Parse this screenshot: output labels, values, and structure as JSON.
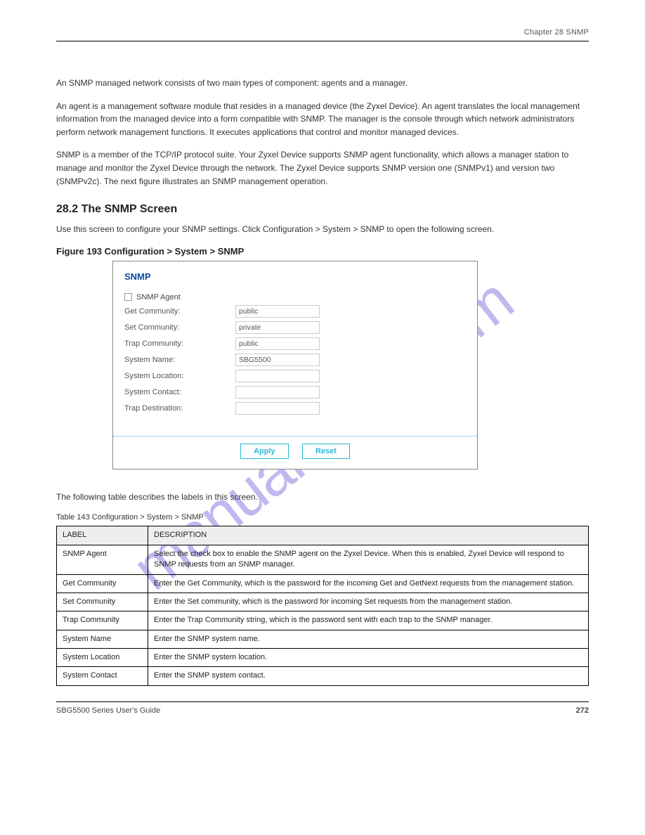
{
  "header": {
    "chapter": "Chapter 28 SNMP"
  },
  "intro": {
    "p1": "An SNMP managed network consists of two main types of component: agents and a manager.",
    "p2": "An agent is a management software module that resides in a managed device (the Zyxel Device). An agent translates the local management information from the managed device into a form compatible with SNMP. The manager is the console through which network administrators perform network management functions. It executes applications that control and monitor managed devices.",
    "p3": "SNMP is a member of the TCP/IP protocol suite. Your Zyxel Device supports SNMP agent functionality, which allows a manager station to manage and monitor the Zyxel Device through the network. The Zyxel Device supports SNMP version one (SNMPv1) and version two (SNMPv2c). The next figure illustrates an SNMP management operation."
  },
  "section": {
    "title": "28.2  The SNMP Screen",
    "lead": "Use this screen to configure your SNMP settings. Click Configuration > System > SNMP to open the following screen.",
    "figcaption": "Figure 193   Configuration > System > SNMP"
  },
  "panel": {
    "title": "SNMP",
    "agent_label": "SNMP Agent",
    "fields": [
      {
        "label": "Get Community:",
        "value": "public"
      },
      {
        "label": "Set Community:",
        "value": "private"
      },
      {
        "label": "Trap Community:",
        "value": "public"
      },
      {
        "label": "System Name:",
        "value": "SBG5500"
      },
      {
        "label": "System Location:",
        "value": ""
      },
      {
        "label": "System Contact:",
        "value": ""
      },
      {
        "label": "Trap Destination:",
        "value": ""
      }
    ],
    "apply": "Apply",
    "reset": "Reset"
  },
  "table": {
    "caption": "The following table describes the labels in this screen.",
    "title": "Table 143   Configuration > System > SNMP",
    "head_label": "LABEL",
    "head_desc": "DESCRIPTION",
    "rows": [
      {
        "label": "SNMP Agent",
        "desc": "Select the check box to enable the SNMP agent on the Zyxel Device. When this is enabled, Zyxel Device will respond to SNMP requests from an SNMP manager."
      },
      {
        "label": "Get Community",
        "desc": "Enter the Get Community, which is the password for the incoming Get and GetNext requests from the management station."
      },
      {
        "label": "Set Community",
        "desc": "Enter the Set community, which is the password for incoming Set requests from the management station."
      },
      {
        "label": "Trap Community",
        "desc": "Enter the Trap Community string, which is the password sent with each trap to the SNMP manager."
      },
      {
        "label": "System Name",
        "desc": "Enter the SNMP system name."
      },
      {
        "label": "System Location",
        "desc": "Enter the SNMP system location."
      },
      {
        "label": "System Contact",
        "desc": "Enter the SNMP system contact."
      }
    ]
  },
  "footer": {
    "left": "SBG5500 Series User's Guide",
    "right": "272"
  },
  "watermark": "manualshive.com"
}
